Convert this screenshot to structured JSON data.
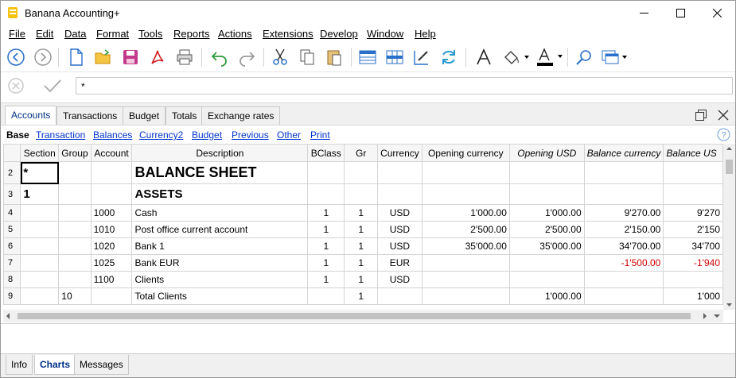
{
  "app": {
    "title": "Banana Accounting+"
  },
  "menu": [
    "File",
    "Edit",
    "Data",
    "Format",
    "Tools",
    "Reports",
    "Actions",
    "Extensions",
    "Develop",
    "Window",
    "Help"
  ],
  "cell_input": {
    "value": "*"
  },
  "tabs": [
    "Accounts",
    "Transactions",
    "Budget",
    "Totals",
    "Exchange rates"
  ],
  "views": [
    "Base",
    "Transaction",
    "Balances",
    "Currency2",
    "Budget",
    "Previous",
    "Other",
    "Print"
  ],
  "columns": [
    "Section",
    "Group",
    "Account",
    "Description",
    "BClass",
    "Gr",
    "Currency",
    "Opening currency",
    "Opening USD",
    "Balance currency",
    "Balance US"
  ],
  "rows": [
    {
      "n": "2",
      "section": "*",
      "group": "",
      "account": "",
      "desc": "BALANCE SHEET",
      "bclass": "",
      "gr": "",
      "cur": "",
      "opc": "",
      "opu": "",
      "bc": "",
      "bu": ""
    },
    {
      "n": "3",
      "section": "1",
      "group": "",
      "account": "",
      "desc": "ASSETS",
      "bclass": "",
      "gr": "",
      "cur": "",
      "opc": "",
      "opu": "",
      "bc": "",
      "bu": ""
    },
    {
      "n": "4",
      "section": "",
      "group": "",
      "account": "1000",
      "desc": "Cash",
      "bclass": "1",
      "gr": "1",
      "cur": "USD",
      "opc": "1'000.00",
      "opu": "1'000.00",
      "bc": "9'270.00",
      "bu": "9'270"
    },
    {
      "n": "5",
      "section": "",
      "group": "",
      "account": "1010",
      "desc": "Post office current account",
      "bclass": "1",
      "gr": "1",
      "cur": "USD",
      "opc": "2'500.00",
      "opu": "2'500.00",
      "bc": "2'150.00",
      "bu": "2'150"
    },
    {
      "n": "6",
      "section": "",
      "group": "",
      "account": "1020",
      "desc": "Bank 1",
      "bclass": "1",
      "gr": "1",
      "cur": "USD",
      "opc": "35'000.00",
      "opu": "35'000.00",
      "bc": "34'700.00",
      "bu": "34'700"
    },
    {
      "n": "7",
      "section": "",
      "group": "",
      "account": "1025",
      "desc": "Bank EUR",
      "bclass": "1",
      "gr": "1",
      "cur": "EUR",
      "opc": "",
      "opu": "",
      "bc": "-1'500.00",
      "bu": "-1'940"
    },
    {
      "n": "8",
      "section": "",
      "group": "",
      "account": "1100",
      "desc": "Clients",
      "bclass": "1",
      "gr": "1",
      "cur": "USD",
      "opc": "",
      "opu": "",
      "bc": "",
      "bu": ""
    },
    {
      "n": "9",
      "section": "",
      "group": "10",
      "account": "",
      "desc": "Total Clients",
      "bclass": "",
      "gr": "1",
      "cur": "",
      "opc": "",
      "opu": "1'000.00",
      "bc": "",
      "bu": "1'000"
    }
  ],
  "bottom_tabs": [
    "Info",
    "Charts",
    "Messages"
  ],
  "colors": {
    "accent": "#003087",
    "negative": "#d00000",
    "link": "#0033cc"
  }
}
